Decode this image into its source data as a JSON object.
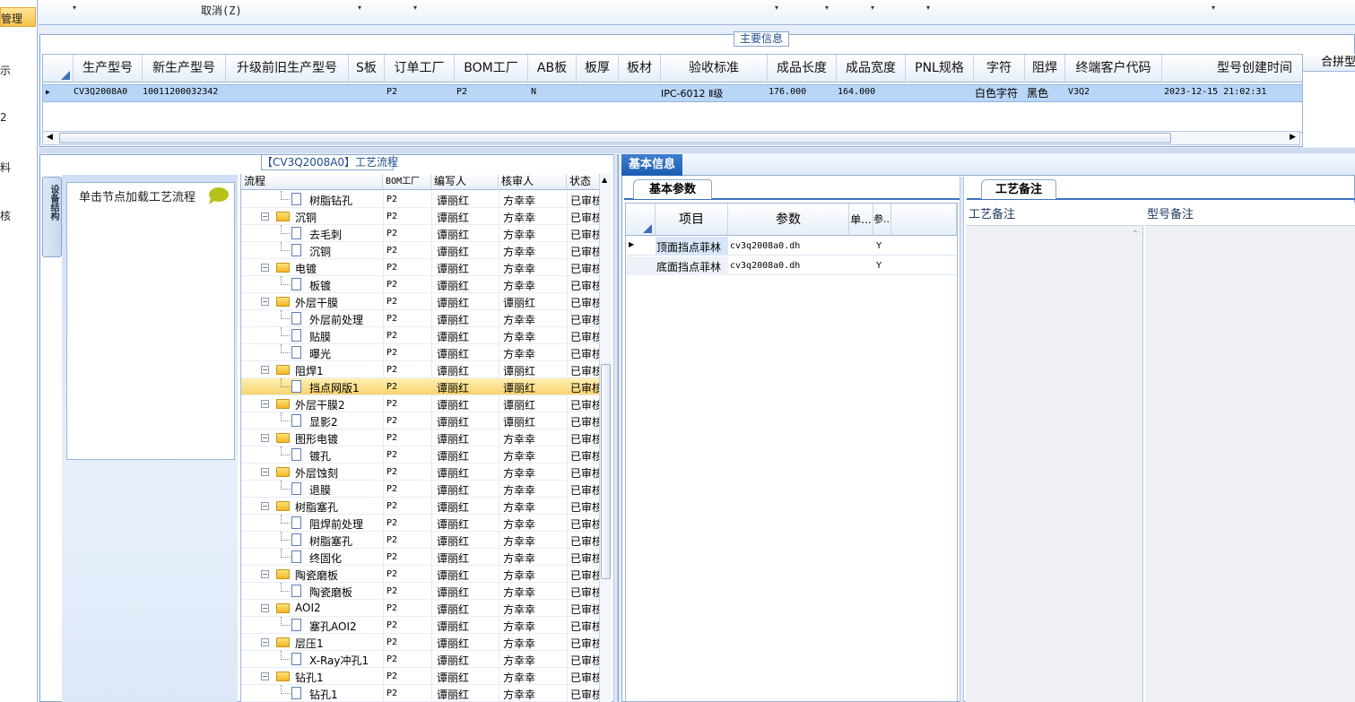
{
  "left_nav": {
    "items": [
      "管理",
      "示",
      "2",
      "料",
      "核"
    ]
  },
  "toolbar": {
    "cancel_label": "取消(Z)",
    "dropdown_glyph": "▾"
  },
  "main_info": {
    "title": "主要信息",
    "columns": [
      "生产型号",
      "新生产型号",
      "升级前旧生产型号",
      "S板",
      "订单工厂",
      "BOM工厂",
      "AB板",
      "板厚",
      "板材",
      "验收标准",
      "成品长度",
      "成品宽度",
      "PNL规格",
      "字符",
      "阻焊",
      "终端客户代码",
      "型号创建时间",
      "合拼型"
    ],
    "row": {
      "生产型号": "CV3Q2008A0",
      "新生产型号": "10011200032342",
      "订单工厂": "P2",
      "BOM工厂": "P2",
      "AB板": "N",
      "验收标准": "IPC-6012 Ⅱ级",
      "成品长度": "176.000",
      "成品宽度": "164.000",
      "字符": "白色字符",
      "阻焊": "黑色",
      "终端客户代码": "V3Q2",
      "型号创建时间": "2023-12-15 21:02:31"
    }
  },
  "flow_panel": {
    "title": "【CV3Q2008A0】工艺流程",
    "vertical_tab": "设备结构",
    "node_label": "单击节点加载工艺流程",
    "columns": [
      "流程",
      "BOM工厂",
      "编写人",
      "核审人",
      "状态"
    ],
    "rows": [
      {
        "level": 2,
        "type": "doc",
        "name": "树脂钻孔",
        "bom": "P2",
        "writer": "谭丽红",
        "reviewer": "方幸幸",
        "status": "已审核"
      },
      {
        "level": 1,
        "type": "folder",
        "name": "沉铜",
        "bom": "P2",
        "writer": "谭丽红",
        "reviewer": "方幸幸",
        "status": "已审核"
      },
      {
        "level": 2,
        "type": "doc",
        "name": "去毛刺",
        "bom": "P2",
        "writer": "谭丽红",
        "reviewer": "方幸幸",
        "status": "已审核"
      },
      {
        "level": 2,
        "type": "doc",
        "name": "沉铜",
        "bom": "P2",
        "writer": "谭丽红",
        "reviewer": "方幸幸",
        "status": "已审核"
      },
      {
        "level": 1,
        "type": "folder",
        "name": "电镀",
        "bom": "P2",
        "writer": "谭丽红",
        "reviewer": "方幸幸",
        "status": "已审核"
      },
      {
        "level": 2,
        "type": "doc",
        "name": "板镀",
        "bom": "P2",
        "writer": "谭丽红",
        "reviewer": "方幸幸",
        "status": "已审核"
      },
      {
        "level": 1,
        "type": "folder",
        "name": "外层干膜",
        "bom": "P2",
        "writer": "谭丽红",
        "reviewer": "谭丽红",
        "status": "已审核"
      },
      {
        "level": 2,
        "type": "doc",
        "name": "外层前处理",
        "bom": "P2",
        "writer": "谭丽红",
        "reviewer": "方幸幸",
        "status": "已审核"
      },
      {
        "level": 2,
        "type": "doc",
        "name": "贴膜",
        "bom": "P2",
        "writer": "谭丽红",
        "reviewer": "方幸幸",
        "status": "已审核"
      },
      {
        "level": 2,
        "type": "doc",
        "name": "曝光",
        "bom": "P2",
        "writer": "谭丽红",
        "reviewer": "方幸幸",
        "status": "已审核"
      },
      {
        "level": 1,
        "type": "folder",
        "name": "阻焊1",
        "bom": "P2",
        "writer": "谭丽红",
        "reviewer": "谭丽红",
        "status": "已审核"
      },
      {
        "level": 2,
        "type": "doc",
        "name": "挡点网版1",
        "bom": "P2",
        "writer": "谭丽红",
        "reviewer": "谭丽红",
        "status": "已审核",
        "selected": true
      },
      {
        "level": 1,
        "type": "folder",
        "name": "外层干膜2",
        "bom": "P2",
        "writer": "谭丽红",
        "reviewer": "谭丽红",
        "status": "已审核"
      },
      {
        "level": 2,
        "type": "doc",
        "name": "显影2",
        "bom": "P2",
        "writer": "谭丽红",
        "reviewer": "谭丽红",
        "status": "已审核"
      },
      {
        "level": 1,
        "type": "folder",
        "name": "图形电镀",
        "bom": "P2",
        "writer": "谭丽红",
        "reviewer": "方幸幸",
        "status": "已审核"
      },
      {
        "level": 2,
        "type": "doc",
        "name": "镀孔",
        "bom": "P2",
        "writer": "谭丽红",
        "reviewer": "方幸幸",
        "status": "已审核"
      },
      {
        "level": 1,
        "type": "folder",
        "name": "外层蚀刻",
        "bom": "P2",
        "writer": "谭丽红",
        "reviewer": "方幸幸",
        "status": "已审核"
      },
      {
        "level": 2,
        "type": "doc",
        "name": "退膜",
        "bom": "P2",
        "writer": "谭丽红",
        "reviewer": "方幸幸",
        "status": "已审核"
      },
      {
        "level": 1,
        "type": "folder",
        "name": "树脂塞孔",
        "bom": "P2",
        "writer": "谭丽红",
        "reviewer": "方幸幸",
        "status": "已审核"
      },
      {
        "level": 2,
        "type": "doc",
        "name": "阻焊前处理",
        "bom": "P2",
        "writer": "谭丽红",
        "reviewer": "方幸幸",
        "status": "已审核"
      },
      {
        "level": 2,
        "type": "doc",
        "name": "树脂塞孔",
        "bom": "P2",
        "writer": "谭丽红",
        "reviewer": "方幸幸",
        "status": "已审核"
      },
      {
        "level": 2,
        "type": "doc",
        "name": "终固化",
        "bom": "P2",
        "writer": "谭丽红",
        "reviewer": "方幸幸",
        "status": "已审核"
      },
      {
        "level": 1,
        "type": "folder",
        "name": "陶瓷磨板",
        "bom": "P2",
        "writer": "谭丽红",
        "reviewer": "方幸幸",
        "status": "已审核"
      },
      {
        "level": 2,
        "type": "doc",
        "name": "陶瓷磨板",
        "bom": "P2",
        "writer": "谭丽红",
        "reviewer": "方幸幸",
        "status": "已审核"
      },
      {
        "level": 1,
        "type": "folder",
        "name": "AOI2",
        "bom": "P2",
        "writer": "谭丽红",
        "reviewer": "方幸幸",
        "status": "已审核"
      },
      {
        "level": 2,
        "type": "doc",
        "name": "塞孔AOI2",
        "bom": "P2",
        "writer": "谭丽红",
        "reviewer": "方幸幸",
        "status": "已审核"
      },
      {
        "level": 1,
        "type": "folder",
        "name": "层压1",
        "bom": "P2",
        "writer": "谭丽红",
        "reviewer": "方幸幸",
        "status": "已审核"
      },
      {
        "level": 2,
        "type": "doc",
        "name": "X-Ray冲孔1",
        "bom": "P2",
        "writer": "谭丽红",
        "reviewer": "方幸幸",
        "status": "已审核"
      },
      {
        "level": 1,
        "type": "folder",
        "name": "钻孔1",
        "bom": "P2",
        "writer": "谭丽红",
        "reviewer": "方幸幸",
        "status": "已审核"
      },
      {
        "level": 2,
        "type": "doc",
        "name": "钻孔1",
        "bom": "P2",
        "writer": "谭丽红",
        "reviewer": "方幸幸",
        "status": "已审核"
      }
    ]
  },
  "basic_info": {
    "tab_label": "基本信息",
    "params_tab": "基本参数",
    "columns": [
      "项目",
      "参数",
      "单...",
      "参..."
    ],
    "rows": [
      {
        "item": "顶面挡点菲林",
        "param": "cv3q2008a0.dh",
        "unit": "",
        "flag": "Y"
      },
      {
        "item": "底面挡点菲林",
        "param": "cv3q2008a0.dh",
        "unit": "",
        "flag": "Y"
      }
    ]
  },
  "process_notes": {
    "tab_label": "工艺备注",
    "col1": "工艺备注",
    "col2": "型号备注"
  }
}
